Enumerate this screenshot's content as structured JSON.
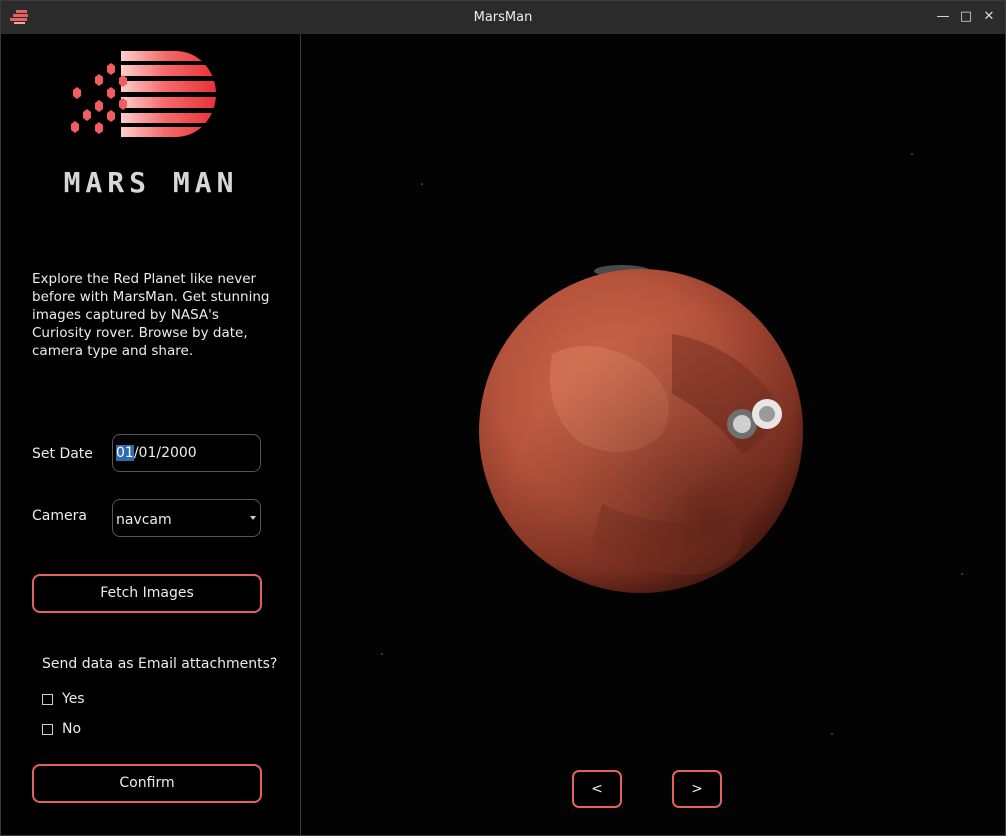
{
  "window": {
    "title": "MarsMan"
  },
  "brand": {
    "name": "MARS MAN"
  },
  "description": "Explore the Red Planet like never before with MarsMan. Get stunning images captured by NASA's Curiosity rover. Browse by date, camera type and share.",
  "form": {
    "date_label": "Set Date",
    "date_selected": "01",
    "date_rest": "/01/2000",
    "camera_label": "Camera",
    "camera_value": "navcam",
    "fetch_label": "Fetch Images",
    "email_question": "Send data as Email attachments?",
    "options": [
      {
        "label": "Yes",
        "checked": false
      },
      {
        "label": "No",
        "checked": false
      }
    ],
    "confirm_label": "Confirm"
  },
  "navigation": {
    "prev_label": "<",
    "next_label": ">"
  },
  "colors": {
    "accent": "#e5615f",
    "background": "#000000",
    "titlebar": "#2b2b2b",
    "mars": "#b84e38",
    "selection": "#2f6bb0"
  },
  "icons": {
    "app": "mars-man-icon",
    "minimize": "minimize-icon",
    "maximize": "maximize-icon",
    "close": "close-icon",
    "dropdown": "chevron-down-icon"
  }
}
